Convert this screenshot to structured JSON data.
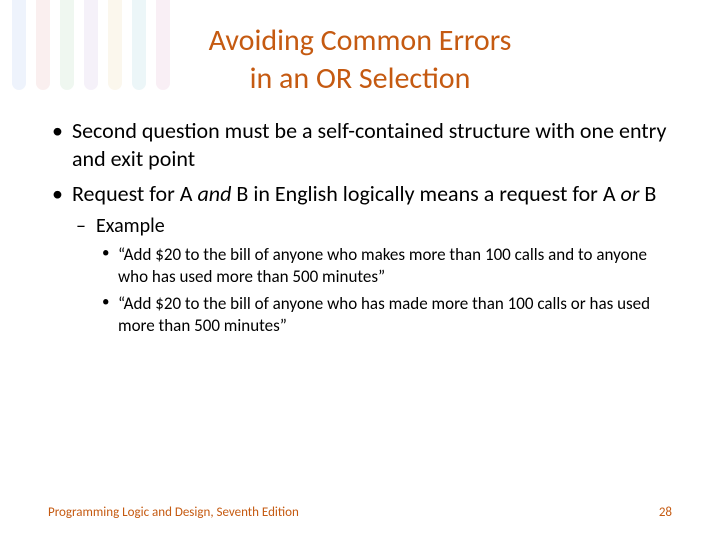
{
  "title_line1": "Avoiding Common Errors",
  "title_line2": "in an OR Selection",
  "bullets": {
    "b1": "Second question must be a self-contained structure with one entry and exit point",
    "b2_a": "Request for A ",
    "b2_and": "and",
    "b2_b": " B in English logically means a request for A ",
    "b2_or": "or",
    "b2_c": " B",
    "example_label": "Example",
    "ex1": "“Add $20 to the bill of anyone who makes more than 100 calls and to anyone who has used more than 500 minutes”",
    "ex2": "“Add $20 to the bill of anyone who has made more than 100 calls or has used more than 500 minutes”"
  },
  "footer_text": "Programming Logic and Design, Seventh Edition",
  "page_number": "28",
  "stripe_colors": [
    "#7aa0e8",
    "#d97f7f",
    "#7fc28c",
    "#b48fd1",
    "#e0c070",
    "#6db7c9",
    "#d27fb0"
  ]
}
